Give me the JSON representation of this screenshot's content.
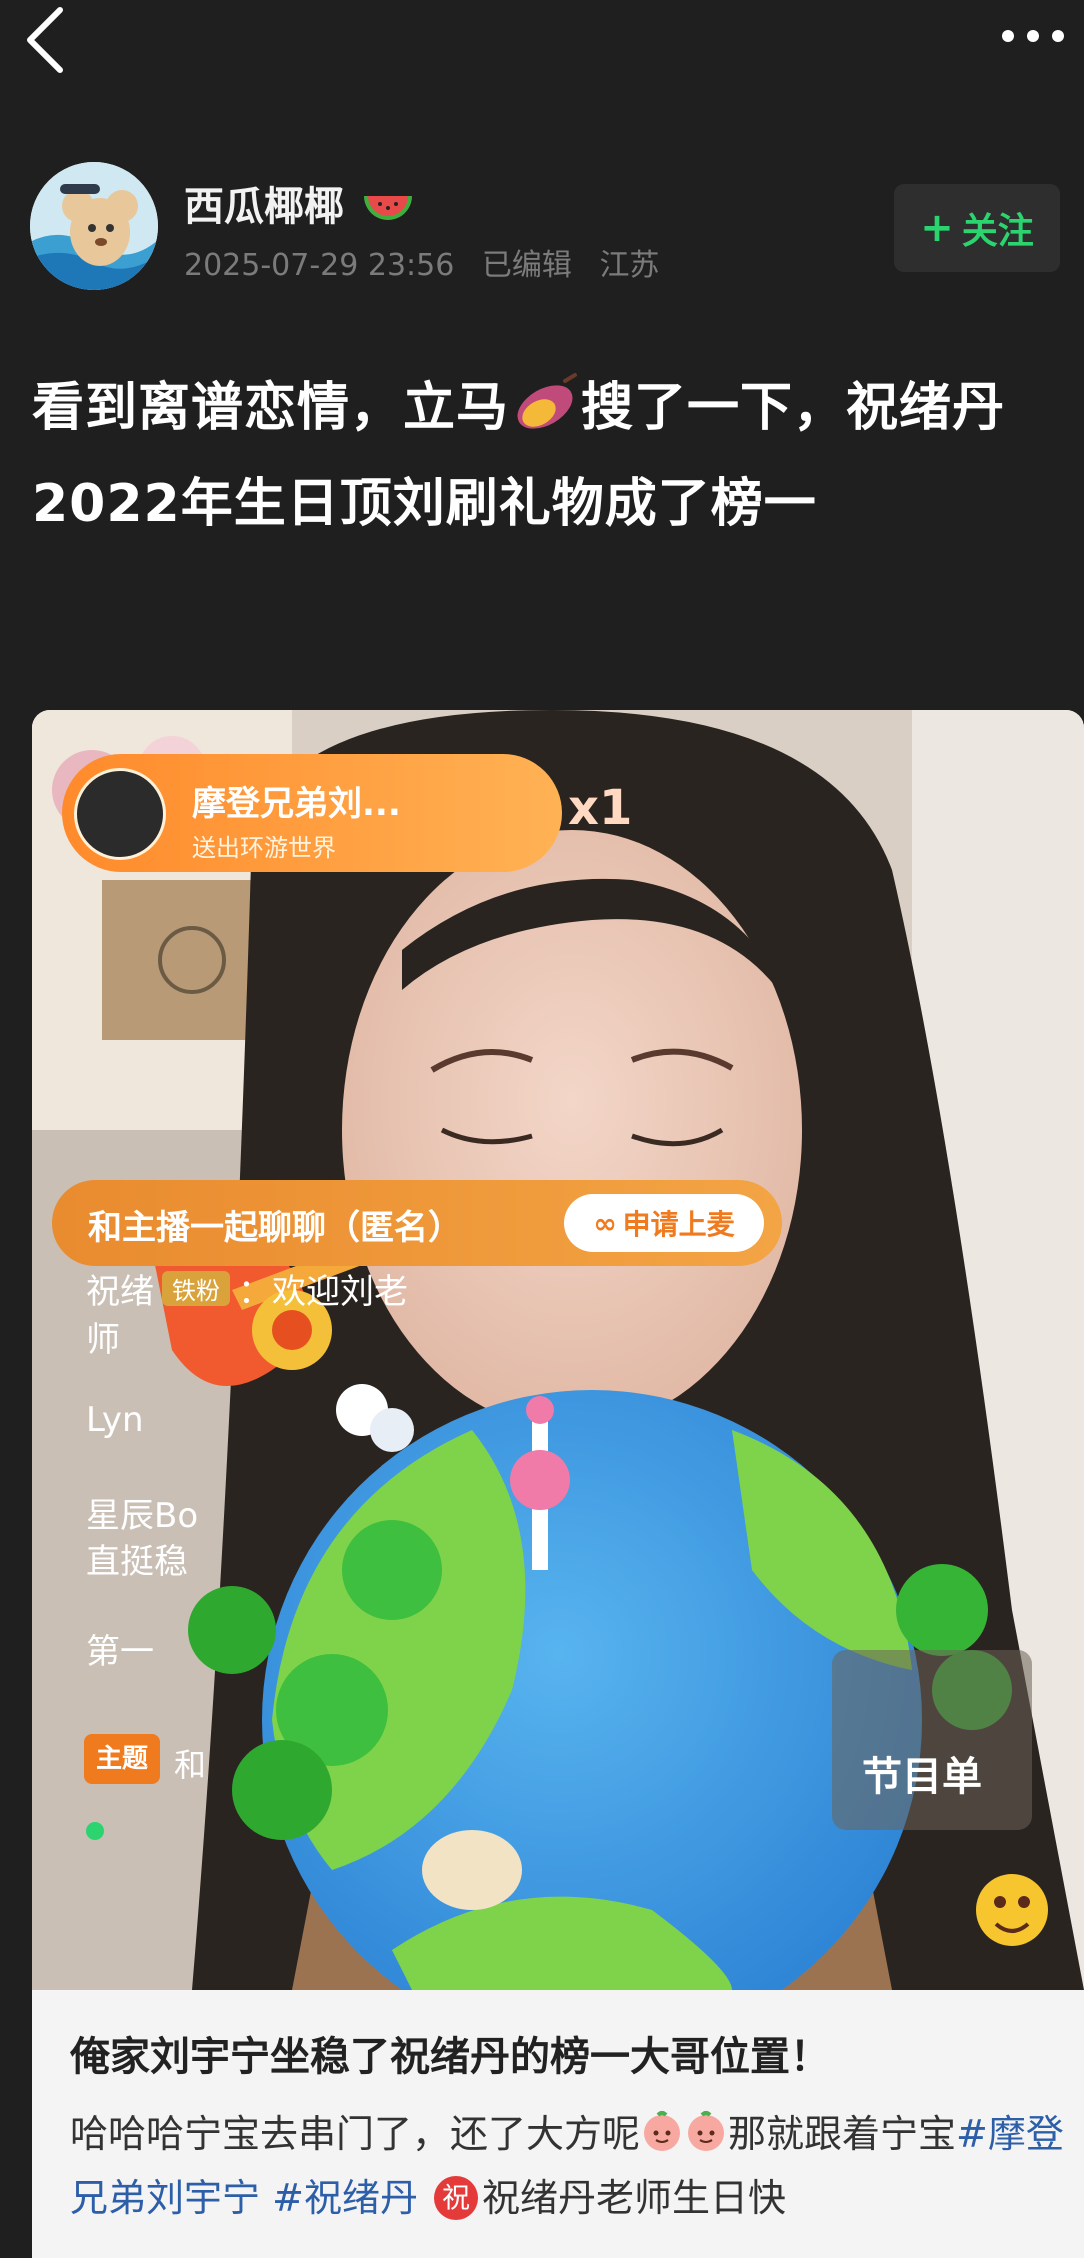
{
  "nav": {
    "back_icon": "chevron-left-icon",
    "more_icon": "more-dots-icon"
  },
  "author": {
    "name": "西瓜椰椰",
    "name_emoji_icon": "watermelon-icon",
    "date": "2025-07-29 23:56",
    "edited": "已编辑",
    "location": "江苏",
    "follow_label": "关注",
    "follow_color": "#2bd46f"
  },
  "post": {
    "title_part1": "看到离谱恋情，立马",
    "title_emoji_icon": "sweet-potato-icon",
    "title_part2": "搜了一下，祝绪丹2022年生日顶刘刷礼物成了榜一"
  },
  "stream": {
    "gift_user": "摩登兄弟刘...",
    "gift_desc": "送出环游世界",
    "gift_count": "x1",
    "chat_banner": "和主播一起聊聊（匿名）",
    "apply_label": "申请上麦",
    "chat_line1_prefix": "祝绪",
    "chat_line1_badge": "铁粉",
    "chat_line1_text": "：欢迎刘老",
    "chat_line2": "师",
    "chat_line3": "Lyn",
    "chat_line4": "星辰Bo",
    "chat_line5": "直挺稳",
    "chat_line6": "第一",
    "topic_tag": "主题",
    "topic_text": "和",
    "program_text": "节目单"
  },
  "card": {
    "title": "俺家刘宇宁坐稳了祝绪丹的榜一大哥位置！",
    "desc_part1": "哈哈哈宁宝去串门了，还了大方呢",
    "desc_part2": "那就跟着宁宝",
    "hashtag1": "#摩登兄弟刘宇宁",
    "hashtag2": "#祝绪丹",
    "zhu_label": "祝",
    "desc_part3": "祝绪丹老师生日快"
  }
}
